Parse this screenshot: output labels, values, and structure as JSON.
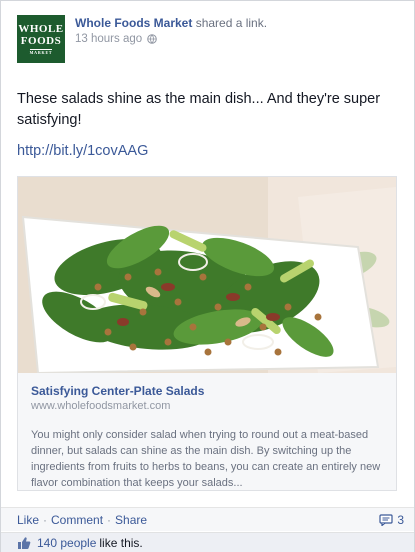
{
  "post": {
    "page_name": "Whole Foods Market",
    "action": "shared a link.",
    "timestamp": "13 hours ago",
    "logo_text": [
      "WHOLE",
      "FOODS",
      "MARKET"
    ],
    "message": "These salads shine as the main dish... And they're super satisfying!",
    "link": "http://bit.ly/1covAAG"
  },
  "attachment": {
    "title": "Satisfying Center-Plate Salads",
    "domain": "www.wholefoodsmarket.com",
    "description": "You might only consider salad when trying to round out a meat-based dinner, but salads can shine as the main dish. By switching up the ingredients from fruits to herbs to beans, you can create an entirely new flavor combination that keeps your salads..."
  },
  "actions": {
    "like": "Like",
    "comment": "Comment",
    "share": "Share",
    "separator": "·",
    "comment_count": "3"
  },
  "likes": {
    "count": "140 people",
    "suffix": "like this."
  },
  "colors": {
    "link_blue": "#3b5998",
    "logo_green": "#1d5b2e",
    "muted_gray": "#9197a3"
  },
  "icons": [
    "globe-icon",
    "comment-bubble-icon",
    "thumbs-up-icon"
  ]
}
